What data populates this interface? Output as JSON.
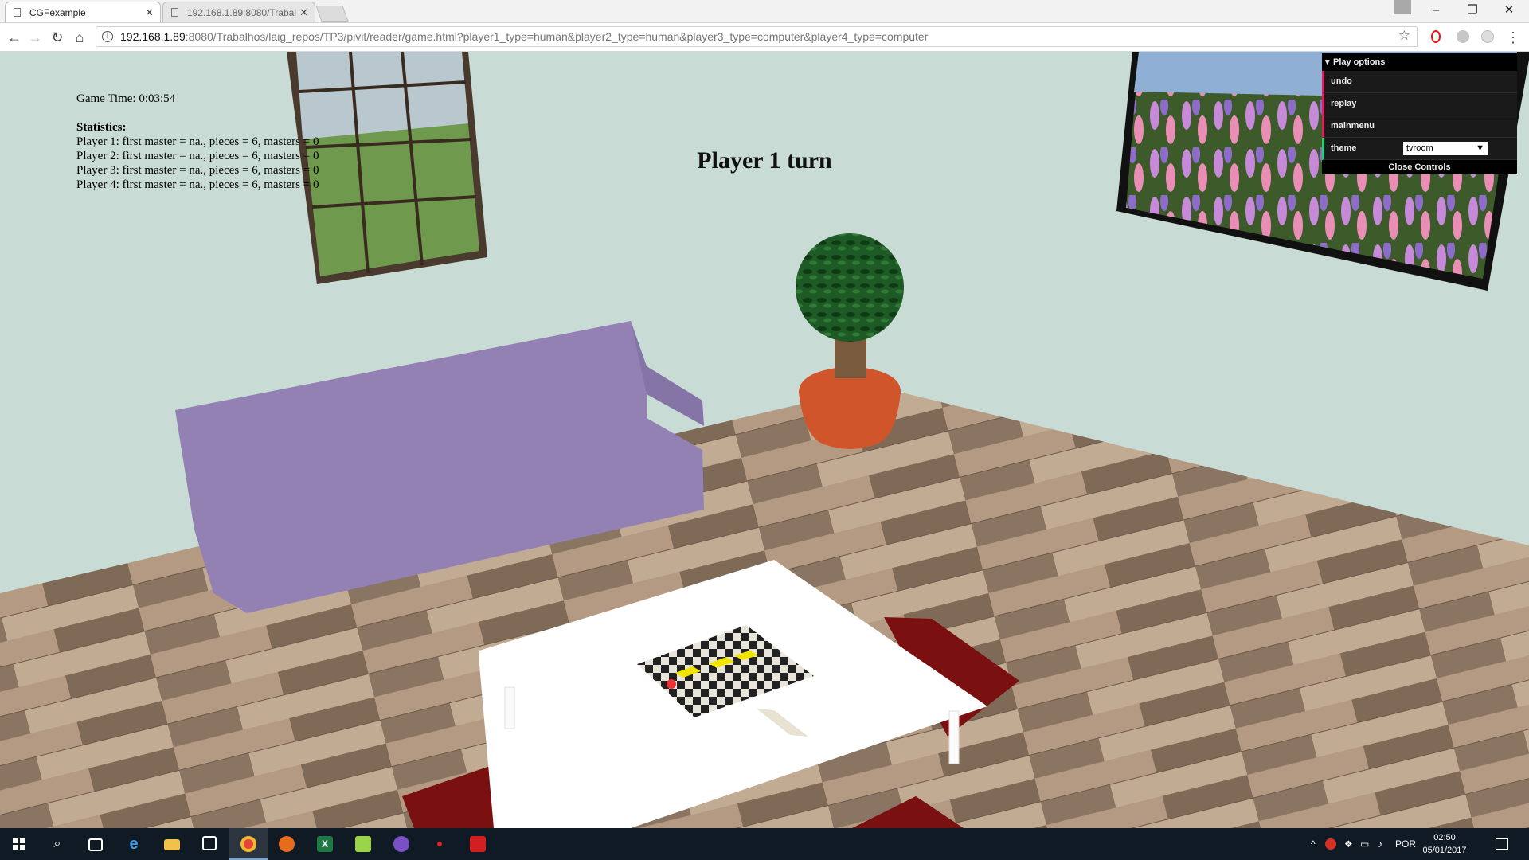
{
  "browser": {
    "tabs": [
      {
        "title": "CGFexample",
        "active": true
      },
      {
        "title": "192.168.1.89:8080/Trabal",
        "active": false
      }
    ],
    "url_host": "192.168.1.89",
    "url_rest": ":8080/Trabalhos/laig_repos/TP3/pivit/reader/game.html?player1_type=human&player2_type=human&player3_type=computer&player4_type=computer",
    "window_buttons": {
      "minimize": "–",
      "restore": "❐",
      "close": "✕"
    }
  },
  "hud": {
    "game_time": "Game Time: 0:03:54",
    "statistics_title": "Statistics:",
    "players": [
      "Player 1: first master = na., pieces = 6, masters = 0",
      "Player 2: first master = na., pieces = 6, masters = 0",
      "Player 3: first master = na., pieces = 6, masters = 0",
      "Player 4: first master = na., pieces = 6, masters = 0"
    ]
  },
  "turn_text": "Player 1 turn",
  "gui": {
    "title": "Play options",
    "buttons": [
      "undo",
      "replay",
      "mainmenu"
    ],
    "theme_label": "theme",
    "theme_value": "tvroom",
    "close_label": "Close Controls"
  },
  "colors": {
    "wall": "#c9dbd5",
    "sofa": "#9481b4",
    "floor": "#9c8672",
    "rug": "#7a1010",
    "table": "#ffffff",
    "tree": "#1e5a25",
    "pot": "#d0552a",
    "gui_function_accent": "#e61d5f",
    "gui_string_accent": "#1ed36f"
  },
  "taskbar": {
    "apps": [
      "start-icon",
      "search-icon",
      "task-view-icon",
      "edge-icon",
      "file-explorer-icon",
      "store-icon",
      "chrome-icon",
      "firefox-icon",
      "excel-icon",
      "notepad-plus-icon",
      "tor-icon",
      "red-app-icon",
      "acrobat-icon"
    ],
    "language": "POR",
    "time": "02:50",
    "date": "05/01/2017"
  }
}
